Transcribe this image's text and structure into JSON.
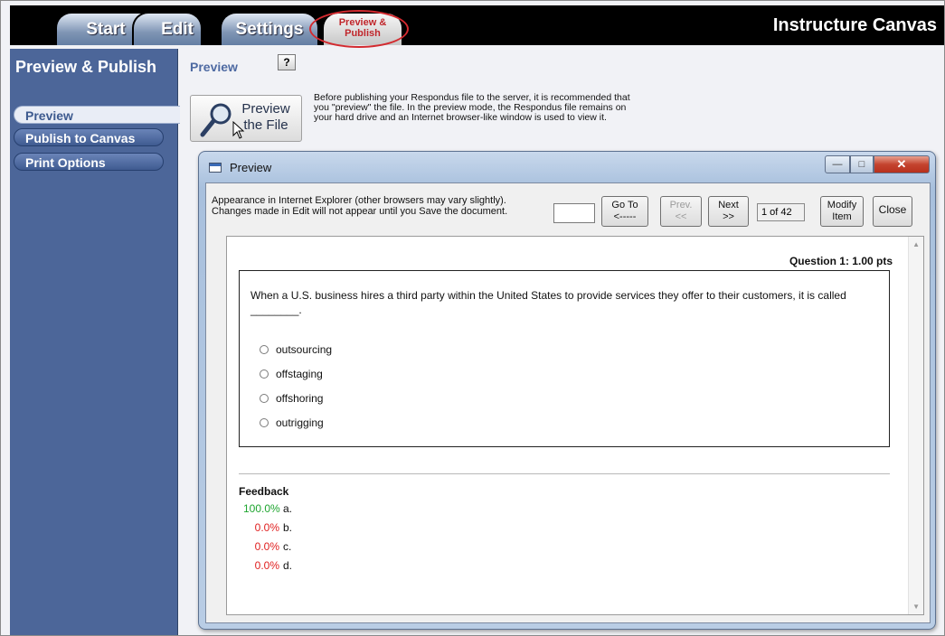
{
  "tabs": {
    "start": "Start",
    "edit": "Edit",
    "settings": "Settings",
    "preview_publish": "Preview & Publish"
  },
  "app_title": "Instructure Canvas",
  "sidebar": {
    "title": "Preview & Publish",
    "items": [
      {
        "label": "Preview",
        "selected": true
      },
      {
        "label": "Publish to Canvas",
        "selected": false
      },
      {
        "label": "Print Options",
        "selected": false
      }
    ]
  },
  "main": {
    "section_label": "Preview",
    "help_label": "?",
    "preview_button": "Preview the File",
    "intro_text": "Before publishing your Respondus file to the server, it is recommended that you \"preview\" the file.  In the preview mode, the Respondus file remains on your hard drive and an Internet browser-like window is used to view it."
  },
  "dialog": {
    "title": "Preview",
    "note_line1": "Appearance in Internet Explorer (other browsers may vary slightly).",
    "note_line2": "Changes made in Edit will not appear until you Save the document.",
    "goto_value": "",
    "goto_label": "Go To",
    "goto_arrow": "<-----",
    "prev_label": "Prev.",
    "prev_arrow": "<<",
    "next_label": "Next",
    "next_arrow": ">>",
    "counter": "1 of 42",
    "modify_line1": "Modify",
    "modify_line2": "Item",
    "close_label": "Close",
    "question_header": "Question 1: 1.00 pts",
    "question_text": "When a U.S. business hires a third party within the United States to provide services they offer to their customers, it is called ________.",
    "choices": [
      "outsourcing",
      "offstaging",
      "offshoring",
      "outrigging"
    ],
    "feedback_title": "Feedback",
    "feedback": [
      {
        "pct": "100.0%",
        "letter": "a."
      },
      {
        "pct": "0.0%",
        "letter": "b."
      },
      {
        "pct": "0.0%",
        "letter": "c."
      },
      {
        "pct": "0.0%",
        "letter": "d."
      }
    ]
  },
  "colors": {
    "accent_red": "#d32a2f",
    "sidebar_blue": "#4c6699",
    "correct_green": "#1ea52f",
    "incorrect_red": "#e02020"
  },
  "icons": [
    "magnifier-icon",
    "cursor-icon",
    "window-icon",
    "minimize-icon",
    "maximize-icon",
    "close-icon",
    "scroll-up-icon",
    "scroll-down-icon"
  ]
}
